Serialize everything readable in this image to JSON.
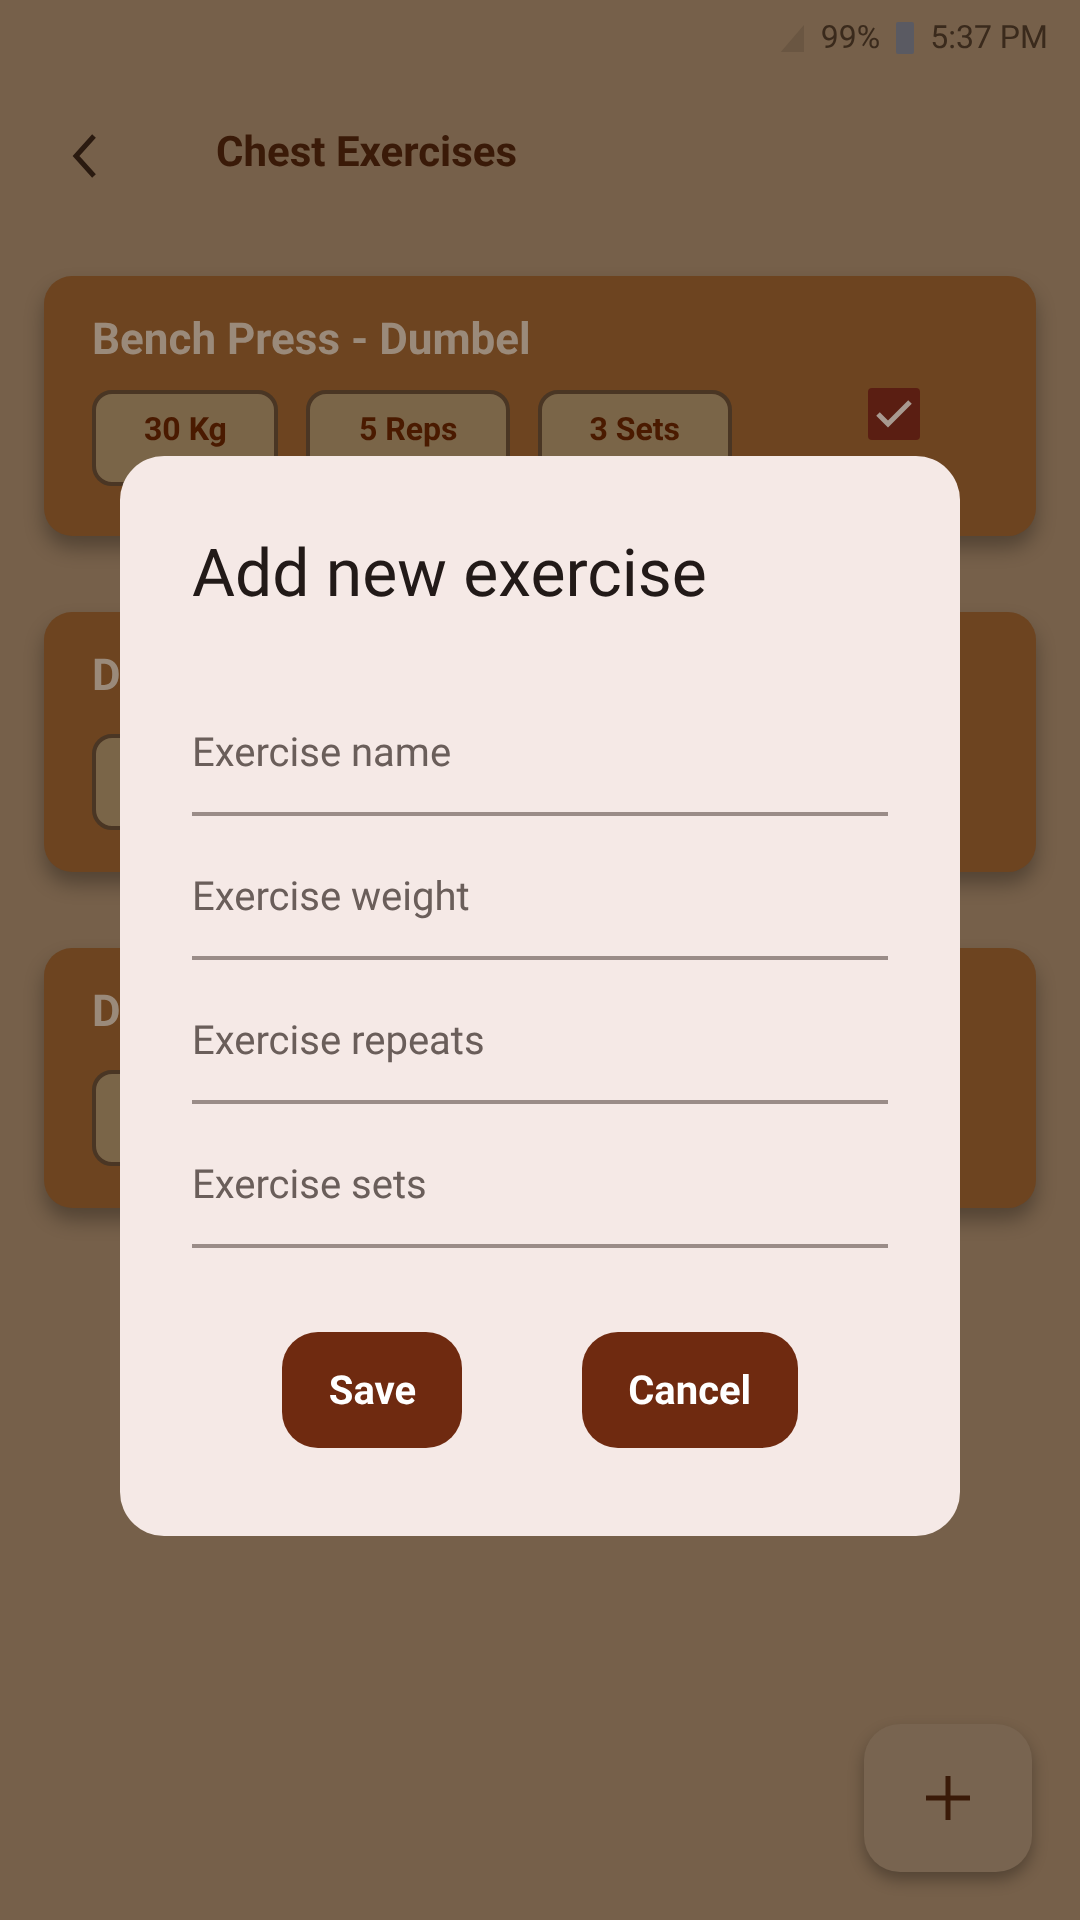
{
  "status_bar": {
    "battery": "99%",
    "time": "5:37 PM"
  },
  "app_bar": {
    "title": "Chest Exercises"
  },
  "cards": [
    {
      "title": "Bench Press - Dumbel",
      "kind": "full",
      "chips": [
        "30 Kg",
        "5 Reps",
        "3 Sets"
      ],
      "checked": true
    },
    {
      "title": "D",
      "kind": "partial"
    },
    {
      "title": "D",
      "kind": "partial"
    }
  ],
  "dialog": {
    "title": "Add new exercise",
    "fields": [
      {
        "placeholder": "Exercise name"
      },
      {
        "placeholder": "Exercise weight"
      },
      {
        "placeholder": "Exercise repeats"
      },
      {
        "placeholder": "Exercise sets"
      }
    ],
    "buttons": [
      "Save",
      "Cancel"
    ]
  }
}
